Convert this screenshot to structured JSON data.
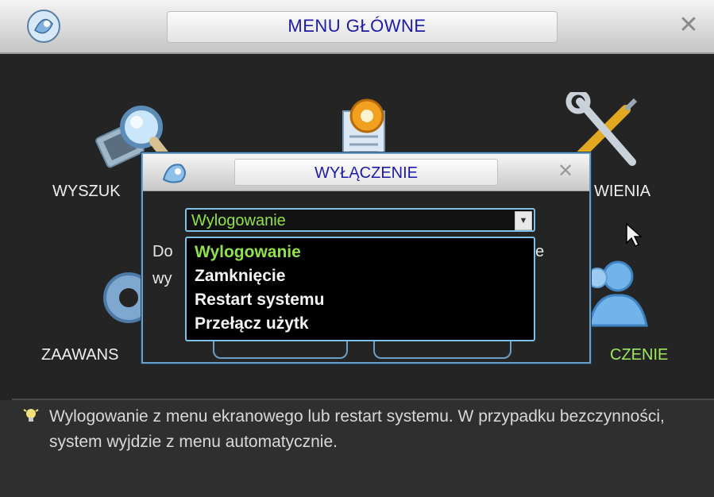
{
  "window": {
    "title": "MENU GŁÓWNE",
    "close_symbol": "✕",
    "logo_icon": "dvr-logo-icon"
  },
  "menu_items": [
    {
      "label": "WYSZUK",
      "icon": "search-magnifier-icon"
    },
    {
      "label": "",
      "icon": "document-gear-icon"
    },
    {
      "label": "WIENIA",
      "icon": "tools-wrench-screwdriver-icon"
    },
    {
      "label": "ZAAWANS",
      "icon": "advanced-gear-icon"
    },
    {
      "label": "CZENIE",
      "icon": "user-shutdown-icon",
      "active": true
    }
  ],
  "dialog": {
    "title": "WYŁĄCZENIE",
    "close_symbol": "✕",
    "select_value": "Wylogowanie",
    "body_fragment_1": "Do",
    "body_fragment_2": "wy",
    "body_fragment_3": "e",
    "options": [
      "Wylogowanie",
      "Zamknięcie",
      "Restart systemu",
      "Przełącz użytk"
    ],
    "selected_index": 0
  },
  "help": {
    "icon": "lightbulb-icon",
    "text": "Wylogowanie z menu ekranowego lub restart systemu. W przypadku bezczynności, system wyjdzie z menu automatycznie."
  },
  "colors": {
    "title_text": "#1d1aa8",
    "active_text": "#8fe24b",
    "dialog_border": "#7ec0e8",
    "background": "#242424"
  }
}
